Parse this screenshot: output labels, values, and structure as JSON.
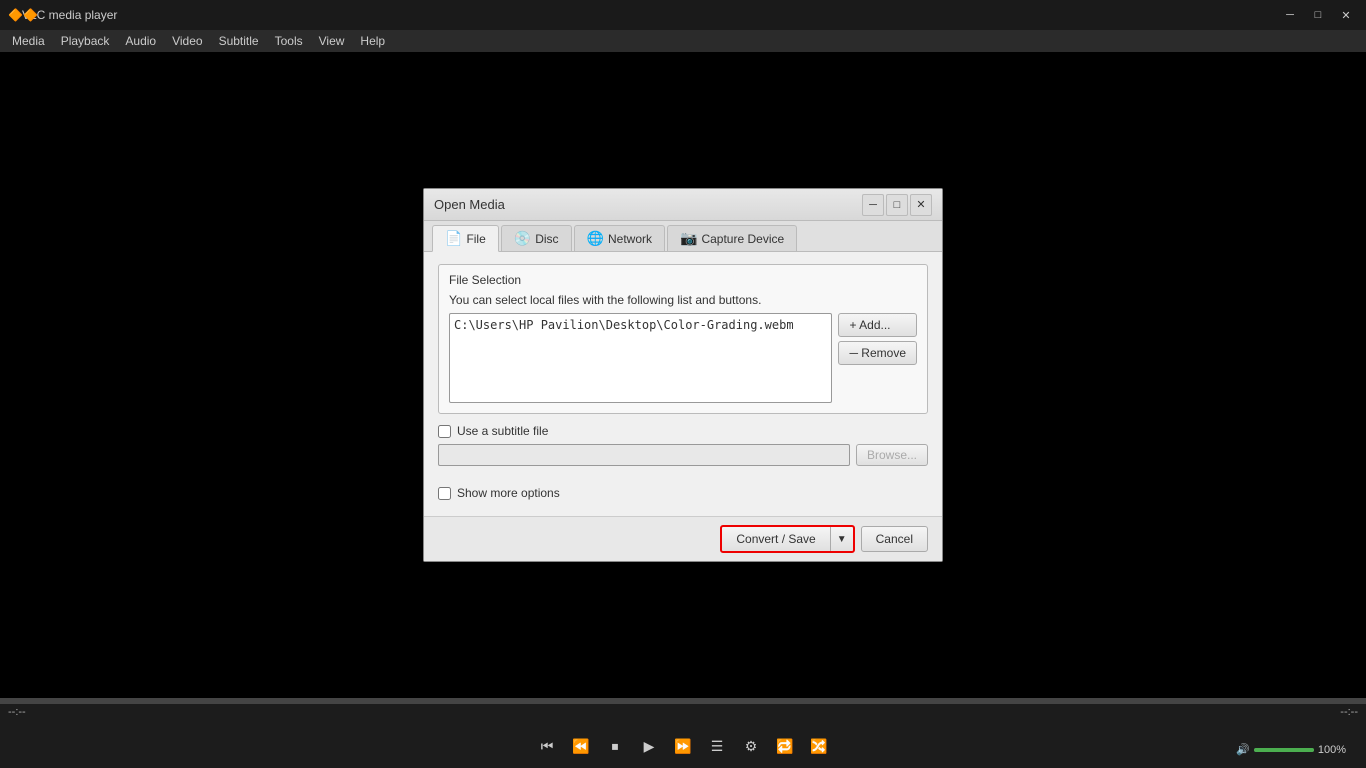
{
  "app": {
    "title": "VLC media player",
    "icon": "🔶"
  },
  "menubar": {
    "items": [
      "Media",
      "Playback",
      "Audio",
      "Video",
      "Subtitle",
      "Tools",
      "View",
      "Help"
    ]
  },
  "titlebar_controls": {
    "minimize": "─",
    "maximize": "□",
    "close": "✕"
  },
  "dialog": {
    "title": "Open Media",
    "minimize": "─",
    "maximize": "□",
    "close": "✕",
    "tabs": [
      {
        "id": "file",
        "label": "File",
        "icon": "📄",
        "active": true
      },
      {
        "id": "disc",
        "label": "Disc",
        "icon": "💿"
      },
      {
        "id": "network",
        "label": "Network",
        "icon": "🌐"
      },
      {
        "id": "capture",
        "label": "Capture Device",
        "icon": "📷"
      }
    ],
    "file_selection": {
      "group_title": "File Selection",
      "hint": "You can select local files with the following list and buttons.",
      "file_path": "C:\\Users\\HP Pavilion\\Desktop\\Color-Grading.webm",
      "add_button": "+ Add...",
      "remove_button": "─ Remove"
    },
    "subtitle": {
      "checkbox_label": "Use a subtitle file",
      "path_placeholder": "",
      "browse_button": "Browse..."
    },
    "show_more": {
      "label": "Show more options"
    },
    "footer": {
      "convert_save": "Convert / Save",
      "arrow": "▼",
      "cancel": "Cancel"
    }
  },
  "bottom_controls": {
    "time_left": "--:--",
    "time_right": "--:--",
    "volume_label": "100%",
    "buttons": [
      "⏮",
      "⏪",
      "⏹",
      "⏯",
      "⏩"
    ]
  }
}
